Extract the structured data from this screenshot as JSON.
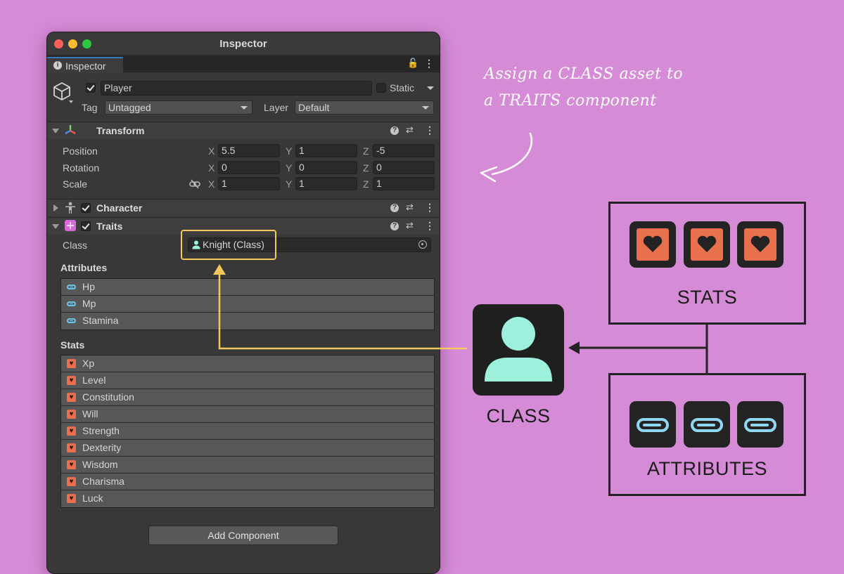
{
  "window": {
    "title": "Inspector",
    "tab_label": "Inspector",
    "lock_glyph": "🔓",
    "menu_glyph": "⋮"
  },
  "gameobject": {
    "active": true,
    "name": "Player",
    "static_label": "Static",
    "tag_label": "Tag",
    "tag_value": "Untagged",
    "layer_label": "Layer",
    "layer_value": "Default"
  },
  "transform": {
    "title": "Transform",
    "rows": [
      {
        "label": "Position",
        "x": "5.5",
        "y": "1",
        "z": "-5"
      },
      {
        "label": "Rotation",
        "x": "0",
        "y": "0",
        "z": "0"
      },
      {
        "label": "Scale",
        "x": "1",
        "y": "1",
        "z": "1"
      }
    ],
    "axis_x": "X",
    "axis_y": "Y",
    "axis_z": "Z"
  },
  "character": {
    "title": "Character",
    "enabled": true
  },
  "traits": {
    "title": "Traits",
    "enabled": true,
    "class_label": "Class",
    "class_value": "Knight (Class)",
    "attributes_title": "Attributes",
    "attributes": [
      "Hp",
      "Mp",
      "Stamina"
    ],
    "stats_title": "Stats",
    "stats": [
      "Xp",
      "Level",
      "Constitution",
      "Will",
      "Strength",
      "Dexterity",
      "Wisdom",
      "Charisma",
      "Luck"
    ]
  },
  "add_component_label": "Add Component",
  "annotation": {
    "line1": "Assign a CLASS asset to",
    "line2": "a TRAITS component"
  },
  "diagram": {
    "stats_label": "STATS",
    "class_label": "CLASS",
    "attributes_label": "ATTRIBUTES"
  },
  "colors": {
    "background": "#d68bd6",
    "highlight": "#f2c95a",
    "stat_orange": "#e8704c",
    "attribute_blue": "#8ed8f4",
    "class_teal": "#9cf0dc"
  }
}
